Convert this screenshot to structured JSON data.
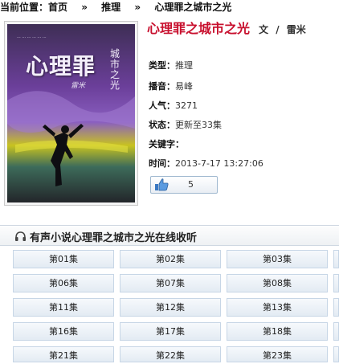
{
  "breadcrumb": {
    "prefix": "当前位置：",
    "home": "首页",
    "sep": "»",
    "category": "推理",
    "current": "心理罪之城市之光"
  },
  "book": {
    "title": "心理罪之城市之光",
    "author_label": "文",
    "slash": "/",
    "author": "雷米",
    "cover_title": "心理罪",
    "cover_subtitle": "城市之光",
    "cover_credit": "雷米",
    "info": [
      {
        "key": "类型：",
        "val": "推理"
      },
      {
        "key": "播音：",
        "val": "易峰"
      },
      {
        "key": "人气：",
        "val": "3271"
      },
      {
        "key": "状态：",
        "val": "更新至33集"
      },
      {
        "key": "关键字：",
        "val": ""
      },
      {
        "key": "时间：",
        "val": "2013-7-17 13:27:06"
      }
    ],
    "likes": "5"
  },
  "section": {
    "title": "有声小说心理罪之城市之光在线收听",
    "icon": "headphones-icon"
  },
  "episodes": [
    "第01集",
    "第02集",
    "第03集",
    "第06集",
    "第07集",
    "第08集",
    "第11集",
    "第12集",
    "第13集",
    "第16集",
    "第17集",
    "第18集",
    "第21集",
    "第22集",
    "第23集"
  ],
  "colors": {
    "title_red": "#c8102e",
    "cover_purple": "#6b3f9a",
    "cover_yellow": "#c8c320"
  }
}
